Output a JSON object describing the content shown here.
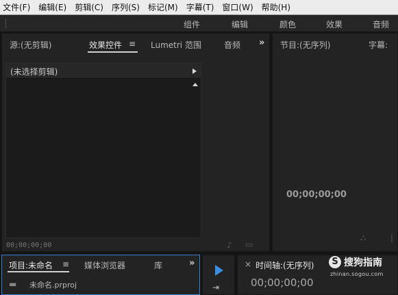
{
  "menubar": {
    "items": [
      "文件(F)",
      "编辑(E)",
      "剪辑(C)",
      "序列(S)",
      "标记(M)",
      "字幕(T)",
      "窗口(W)",
      "帮助(H)"
    ]
  },
  "workspaces": {
    "items": [
      "组件",
      "编辑",
      "颜色",
      "效果",
      "音频"
    ]
  },
  "source_panel": {
    "tabs": [
      "源:(无剪辑)",
      "效果控件",
      "Lumetri 范围",
      "音频"
    ],
    "active_tab": "效果控件",
    "no_clip_label": "(未选择剪辑)",
    "timecode": "00;00;00;00"
  },
  "program_panel": {
    "tabs": [
      "节目:(无序列)",
      "字幕:"
    ],
    "timecode": "00;00;00;00"
  },
  "project_panel": {
    "tabs": [
      "项目:未命名",
      "媒体浏览器",
      "库"
    ],
    "active_tab": "项目:未命名",
    "file_name": "未命名.prproj"
  },
  "timeline_panel": {
    "title": "时间轴:(无序列)",
    "timecode": "00;00;00;00"
  },
  "watermark": {
    "logo_letter": "S",
    "name": "搜狗指南",
    "url": "zhinan.sogou.com"
  },
  "icons": {
    "overflow": "double-chevron-right-icon",
    "menu": "hamburger-menu-icon",
    "play": "play-triangle-icon",
    "selection": "selection-tool-icon",
    "folder": "folder-icon"
  },
  "colors": {
    "accent_blue": "#3b8fe0",
    "panel_bg": "#232323",
    "menubar_bg": "#ececec"
  }
}
